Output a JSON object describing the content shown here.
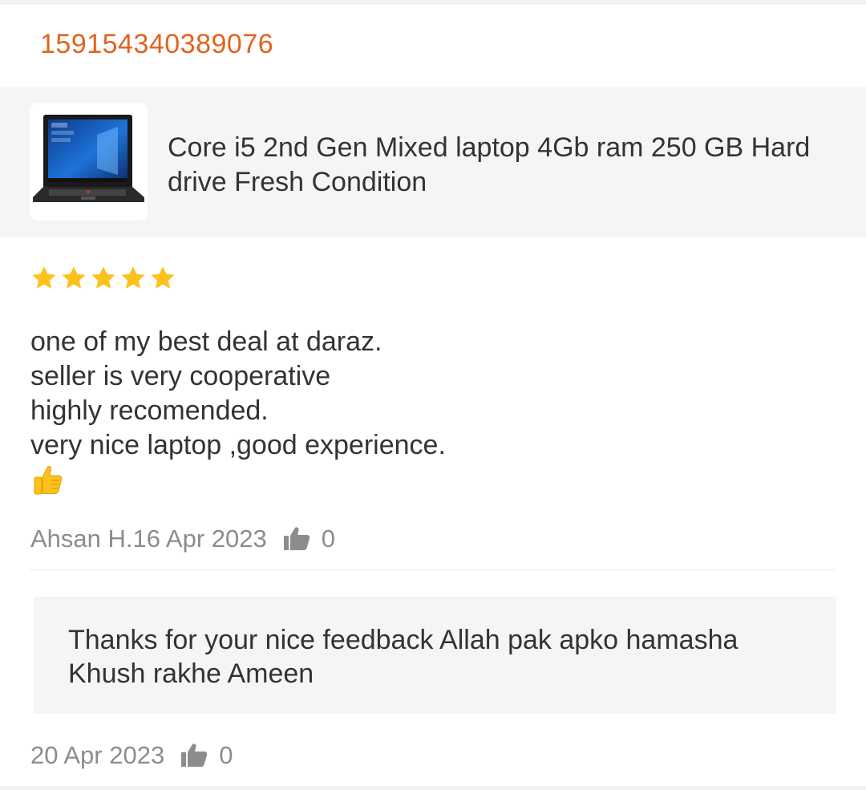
{
  "order": {
    "id": "159154340389076"
  },
  "product": {
    "title": "Core i5 2nd Gen Mixed laptop 4Gb ram 250 GB Hard drive Fresh Condition",
    "image_icon": "laptop-thumbnail"
  },
  "review": {
    "rating": 5,
    "rating_max": 5,
    "lines": [
      "one of my best deal at daraz.",
      "seller is very cooperative",
      "highly recomended.",
      "very nice laptop ,good experience."
    ],
    "emoji": "thumbs-up-emoji",
    "author_date": "Ahsan H.16 Apr 2023",
    "likes": "0"
  },
  "reply": {
    "text": "Thanks for your nice feedback Allah pak apko hamasha Khush rakhe Ameen",
    "date": "20 Apr 2023",
    "likes": "0"
  },
  "colors": {
    "accent": "#e0641e",
    "star": "#fcc21b",
    "muted_text": "#8c8c8c",
    "panel_bg": "#f5f5f5"
  }
}
